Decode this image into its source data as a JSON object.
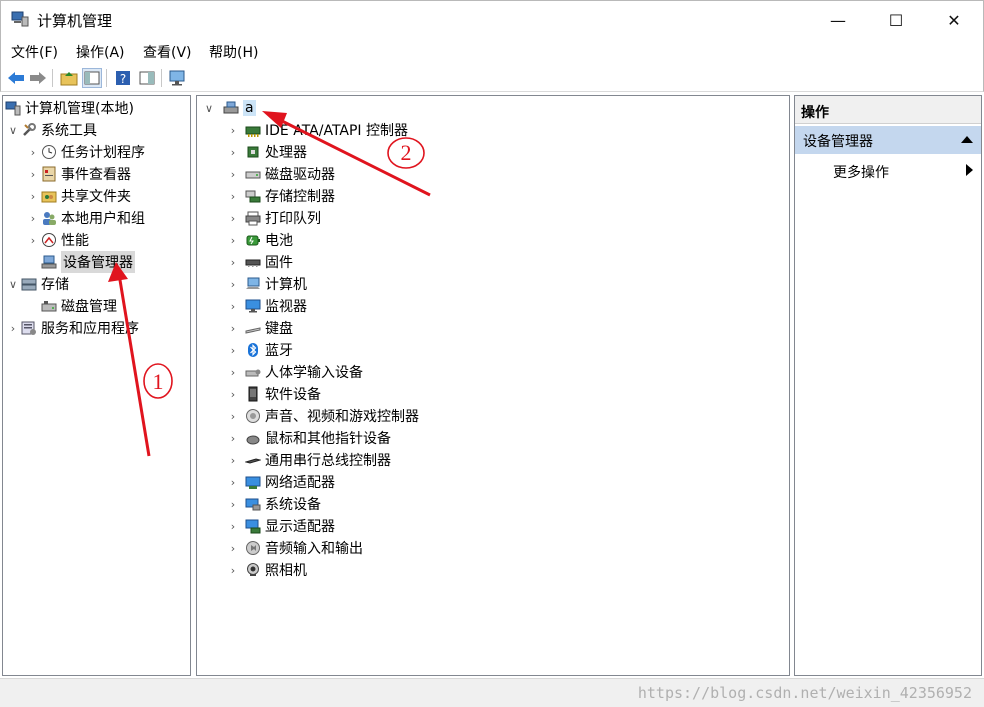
{
  "window": {
    "title": "计算机管理",
    "controls": {
      "minimize": "—",
      "maximize": "☐",
      "close": "✕"
    }
  },
  "menu": {
    "items": [
      {
        "label": "文件(F)"
      },
      {
        "label": "操作(A)"
      },
      {
        "label": "查看(V)"
      },
      {
        "label": "帮助(H)"
      }
    ]
  },
  "toolbar": {
    "buttons": [
      "back-arrow-icon",
      "forward-arrow-icon",
      "up-folder-icon",
      "show-hide-tree-icon",
      "help-icon",
      "properties-icon",
      "monitor-icon"
    ]
  },
  "left_tree": {
    "root": "计算机管理(本地)",
    "system_tools": "系统工具",
    "task_scheduler": "任务计划程序",
    "event_viewer": "事件查看器",
    "shared_folders": "共享文件夹",
    "local_users": "本地用户和组",
    "performance": "性能",
    "device_manager": "设备管理器",
    "storage": "存储",
    "disk_management": "磁盘管理",
    "services_apps": "服务和应用程序"
  },
  "device_tree": {
    "computer_name": "a",
    "categories": [
      {
        "label": "IDE ATA/ATAPI 控制器",
        "icon": "ide-controller-icon"
      },
      {
        "label": "处理器",
        "icon": "processor-icon"
      },
      {
        "label": "磁盘驱动器",
        "icon": "disk-drive-icon"
      },
      {
        "label": "存储控制器",
        "icon": "storage-controller-icon"
      },
      {
        "label": "打印队列",
        "icon": "print-queue-icon"
      },
      {
        "label": "电池",
        "icon": "battery-icon"
      },
      {
        "label": "固件",
        "icon": "firmware-icon"
      },
      {
        "label": "计算机",
        "icon": "computer-icon"
      },
      {
        "label": "监视器",
        "icon": "monitor-icon"
      },
      {
        "label": "键盘",
        "icon": "keyboard-icon"
      },
      {
        "label": "蓝牙",
        "icon": "bluetooth-icon"
      },
      {
        "label": "人体学输入设备",
        "icon": "hid-icon"
      },
      {
        "label": "软件设备",
        "icon": "software-device-icon"
      },
      {
        "label": "声音、视频和游戏控制器",
        "icon": "sound-icon"
      },
      {
        "label": "鼠标和其他指针设备",
        "icon": "mouse-icon"
      },
      {
        "label": "通用串行总线控制器",
        "icon": "usb-icon"
      },
      {
        "label": "网络适配器",
        "icon": "network-adapter-icon"
      },
      {
        "label": "系统设备",
        "icon": "system-device-icon"
      },
      {
        "label": "显示适配器",
        "icon": "display-adapter-icon"
      },
      {
        "label": "音频输入和输出",
        "icon": "audio-io-icon"
      },
      {
        "label": "照相机",
        "icon": "camera-icon"
      }
    ]
  },
  "actions_pane": {
    "header": "操作",
    "section": "设备管理器",
    "more_actions": "更多操作"
  },
  "annotations": {
    "label_1": "1",
    "label_2": "2",
    "color": "#e0141e"
  },
  "watermark": "https://blog.csdn.net/weixin_42356952"
}
